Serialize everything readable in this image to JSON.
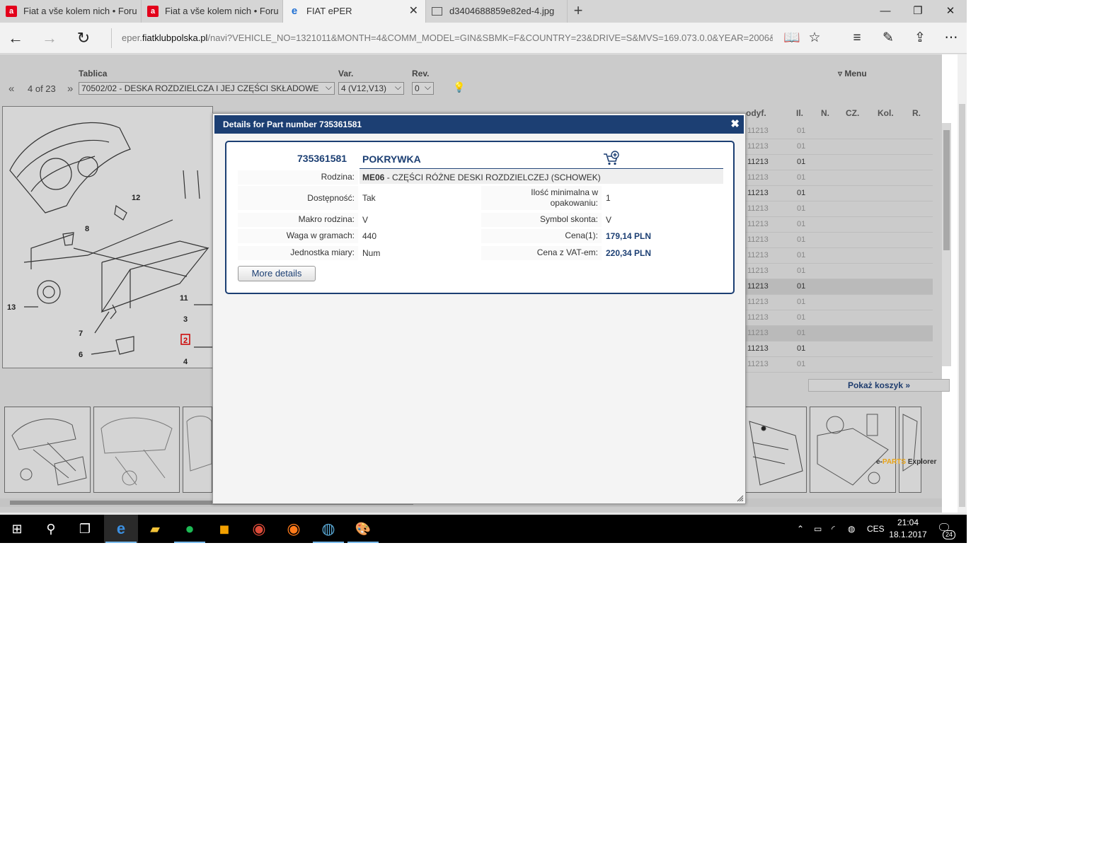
{
  "browser": {
    "tabs": [
      {
        "title": "Fiat a vše kolem nich • Foru",
        "icon": "alza-icon"
      },
      {
        "title": "Fiat a vše kolem nich • Foru",
        "icon": "alza-icon"
      },
      {
        "title": "FIAT ePER",
        "icon": "edge-icon",
        "active": true
      },
      {
        "title": "d3404688859e82ed-4.jpg",
        "icon": "image-icon"
      }
    ],
    "url_prefix": "eper.",
    "url_domain": "fiatklubpolska.pl",
    "url_rest": "/navi?VEHICLE_NO=1321011&MONTH=4&COMM_MODEL=GIN&SBMK=F&COUNTRY=23&DRIVE=S&MVS=169.073.0.0&YEAR=2006&CO"
  },
  "eper": {
    "table_label": "Tablica",
    "var_label": "Var.",
    "rev_label": "Rev.",
    "menu_label": "Menu",
    "page_counter": "4 of 23",
    "table_value": "70502/02 - DESKA ROZDZIELCZA I JEJ CZĘŚCI SKŁADOWE",
    "var_value": "4 (V12,V13)",
    "rev_value": "0",
    "grid_headers": [
      "odyf.",
      "Il.",
      "N.",
      "CZ.",
      "Kol.",
      "R."
    ],
    "grid_rows": [
      {
        "mod": "11213",
        "qty": "01",
        "dark": false,
        "hl": false
      },
      {
        "mod": "11213",
        "qty": "01",
        "dark": false,
        "hl": false
      },
      {
        "mod": "11213",
        "qty": "01",
        "dark": true,
        "hl": false
      },
      {
        "mod": "11213",
        "qty": "01",
        "dark": false,
        "hl": false
      },
      {
        "mod": "11213",
        "qty": "01",
        "dark": true,
        "hl": false
      },
      {
        "mod": "11213",
        "qty": "01",
        "dark": false,
        "hl": false
      },
      {
        "mod": "11213",
        "qty": "01",
        "dark": false,
        "hl": false
      },
      {
        "mod": "11213",
        "qty": "01",
        "dark": false,
        "hl": false
      },
      {
        "mod": "11213",
        "qty": "01",
        "dark": false,
        "hl": false
      },
      {
        "mod": "11213",
        "qty": "01",
        "dark": false,
        "hl": false
      },
      {
        "mod": "11213",
        "qty": "01",
        "dark": true,
        "hl": true
      },
      {
        "mod": "11213",
        "qty": "01",
        "dark": false,
        "hl": false
      },
      {
        "mod": "11213",
        "qty": "01",
        "dark": false,
        "hl": false
      },
      {
        "mod": "11213",
        "qty": "01",
        "dark": false,
        "hl": true
      },
      {
        "mod": "11213",
        "qty": "01",
        "dark": true,
        "hl": false
      },
      {
        "mod": "11213",
        "qty": "01",
        "dark": false,
        "hl": false
      }
    ],
    "diagram_labels": [
      "12",
      "8",
      "13",
      "11",
      "3",
      "7",
      "2",
      "6",
      "4"
    ],
    "cart_button": "Pokaż koszyk »",
    "brand_e": "e-",
    "brand_parts": "PARTS",
    "brand_explorer": " Explorer"
  },
  "modal": {
    "title": "Details for Part number 735361581",
    "part_number": "735361581",
    "part_name": "POKRYWKA",
    "rodzina_label": "Rodzina:",
    "rodzina_code": "ME06",
    "rodzina_desc": " - CZĘŚCI RÓŻNE DESKI ROZDZIELCZEJ (SCHOWEK)",
    "left_fields": [
      {
        "label": "Dostępność:",
        "value": "Tak"
      },
      {
        "label": "Makro rodzina:",
        "value": "V"
      },
      {
        "label": "Waga w gramach:",
        "value": "440"
      },
      {
        "label": "Jednostka miary:",
        "value": "Num"
      }
    ],
    "right_fields": [
      {
        "label": "Ilość minimalna w opakowaniu:",
        "value": "1",
        "price": false
      },
      {
        "label": "Symbol skonta:",
        "value": "V",
        "price": false
      },
      {
        "label": "Cena(1):",
        "value": "179,14 PLN",
        "price": true
      },
      {
        "label": "Cena z VAT-em:",
        "value": "220,34 PLN",
        "price": true
      }
    ],
    "more_details": "More details"
  },
  "taskbar": {
    "language": "CES",
    "time": "21:04",
    "date": "18.1.2017",
    "notifications": "24"
  },
  "colors": {
    "navy": "#1c3f73",
    "taskbar": "#000000",
    "accent": "#76b9ed"
  }
}
